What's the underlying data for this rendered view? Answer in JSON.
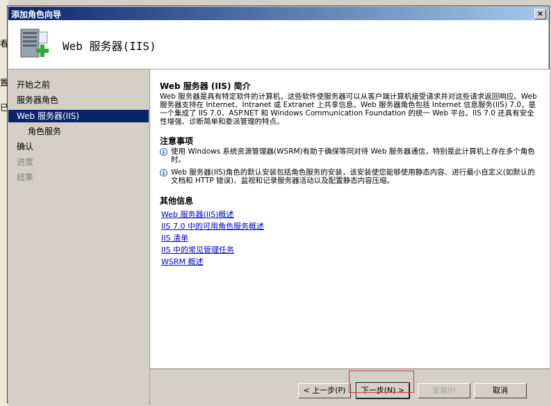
{
  "background_edge": [
    "看",
    "置",
    "已"
  ],
  "window": {
    "title": "添加角色向导",
    "close_glyph": "×"
  },
  "header": {
    "title": "Web 服务器(IIS)",
    "icon": "server-plus-icon"
  },
  "nav": {
    "items": [
      {
        "label": "开始之前"
      },
      {
        "label": "服务器角色"
      },
      {
        "label": "Web 服务器(IIS)"
      },
      {
        "label": "角色服务"
      },
      {
        "label": "确认"
      },
      {
        "label": "进度"
      },
      {
        "label": "结果"
      }
    ],
    "selected": "Web 服务器(IIS)"
  },
  "content": {
    "intro_title": "Web 服务器 (IIS) 简介",
    "intro_text": "Web 服务器是具有特定软件的计算机，这些软件使服务器可以从客户端计算机接受请求并对这些请求返回响应。Web 服务器支持在 Internet、Intranet 或 Extranet 上共享信息。Web 服务器角色包括 Internet 信息服务(IIS) 7.0，是一个集成了 IIS 7.0、ASP.NET 和 Windows Communication Foundation 的统一 Web 平台。IIS 7.0 还具有安全性增强、诊断简单和委派管理的特点。",
    "notes_title": "注意事项",
    "notes": [
      "使用 Windows 系统资源管理器(WSRM)有助于确保等同对待 Web 服务器通信，特别是此计算机上存在多个角色时。",
      "Web 服务器(IIS)角色的默认安装包括角色服务的安装，该安装使您能够使用静态内容、进行最小自定义(如默认的文档和 HTTP 错误)、监视和记录服务器活动以及配置静态内容压缩。"
    ],
    "info_title": "其他信息",
    "links": [
      "Web 服务器(IIS)概述",
      "IIS 7.0 中的可用角色服务概述",
      "IIS 清单",
      "IIS 中的常见管理任务",
      "WSRM 概述"
    ]
  },
  "buttons": {
    "prev": "< 上一步(P)",
    "next": "下一步(N) >",
    "install": "安装(I)",
    "cancel": "取消"
  },
  "colors": {
    "selection": "#0a246a",
    "titlebar_start": "#0a246a",
    "titlebar_end": "#a6caf0",
    "link": "#0000cc",
    "highlight_box": "#e03030"
  }
}
